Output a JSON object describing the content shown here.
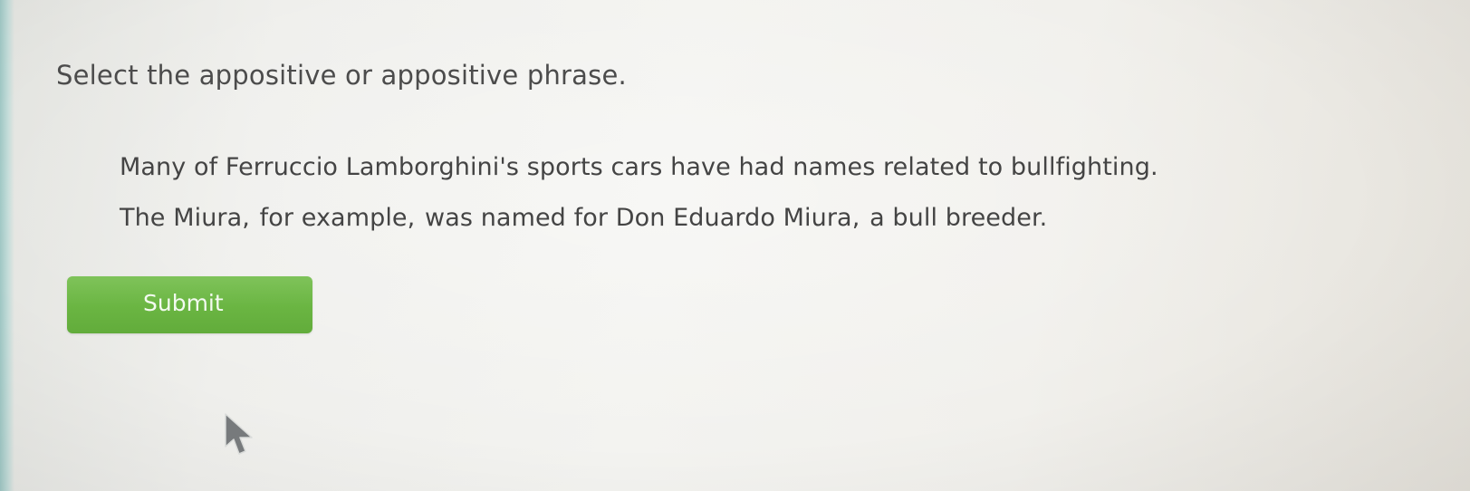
{
  "question": {
    "instruction": "Select the appositive or appositive phrase."
  },
  "passage": {
    "sentences": [
      {
        "phrases": [
          "Many of Ferruccio Lamborghini's sports cars have had names related to bullfighting."
        ]
      },
      {
        "phrases": [
          "The Miura,",
          "for example,",
          "was named for Don Eduardo Miura,",
          "a bull breeder."
        ]
      }
    ]
  },
  "actions": {
    "submit_label": "Submit"
  },
  "colors": {
    "submit_green": "#6ab542",
    "text_gray": "#444444"
  },
  "icons": {
    "mouse_pointer": "mouse-pointer-icon"
  }
}
